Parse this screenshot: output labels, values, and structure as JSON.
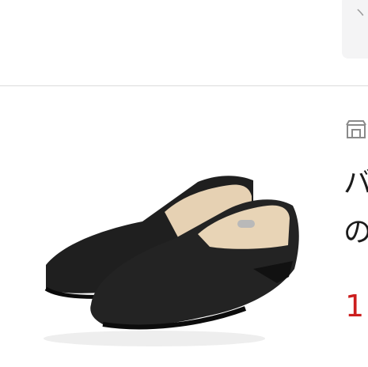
{
  "header": {
    "chip_text": "ヽ"
  },
  "product": {
    "image_icon": "black-slip-on-shoes",
    "store_icon": "store-icon",
    "title_line_1": "バ",
    "title_line_2": "の",
    "price": "1"
  },
  "colors": {
    "price": "#cc1e1e",
    "divider": "#dcdcdc",
    "chip_bg": "#f4f4f5"
  }
}
